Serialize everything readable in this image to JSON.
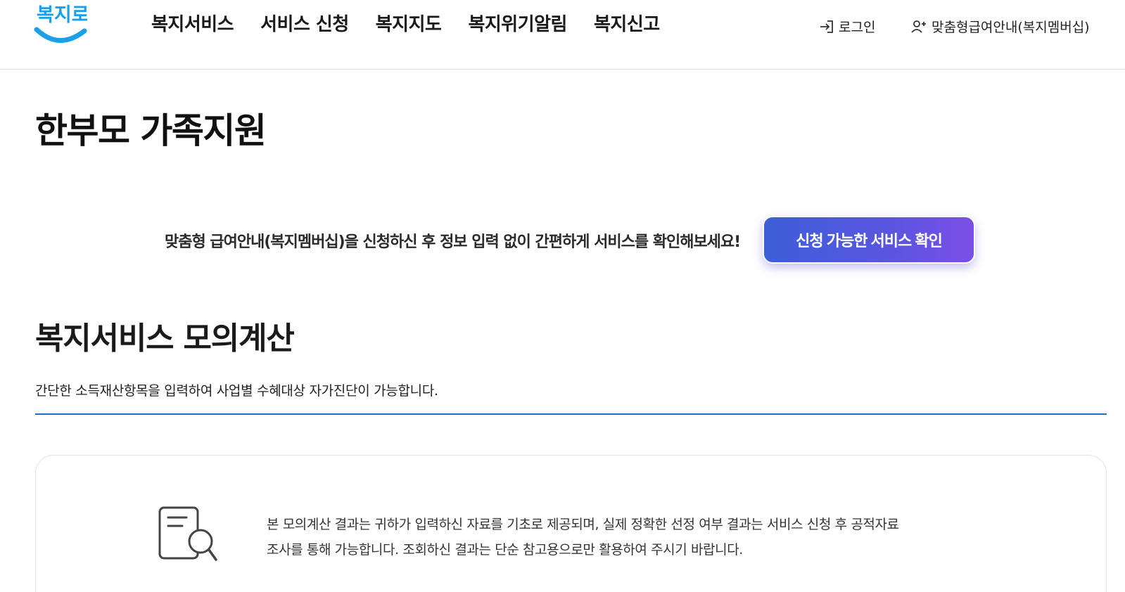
{
  "header": {
    "logo_text": "복지로",
    "nav": [
      {
        "label": "복지서비스"
      },
      {
        "label": "서비스 신청"
      },
      {
        "label": "복지지도"
      },
      {
        "label": "복지위기알림"
      },
      {
        "label": "복지신고"
      }
    ],
    "login_label": "로그인",
    "login_icon": "login-icon",
    "member_label": "맞춤형급여안내(복지멤버십)",
    "member_icon": "user-plus-icon"
  },
  "page": {
    "title": "한부모 가족지원"
  },
  "promo": {
    "text": "맞춤형 급여안내(복지멤버십)을 신청하신 후 정보 입력 없이 간편하게 서비스를 확인해보세요!",
    "button_label": "신청 가능한 서비스 확인"
  },
  "section": {
    "title": "복지서비스 모의계산",
    "description": "간단한 소득재산항목을 입력하여 사업별 수혜대상 자가진단이 가능합니다."
  },
  "notice": {
    "icon": "document-search-icon",
    "line1": "본 모의계산 결과는 귀하가 입력하신 자료를 기초로 제공되며, 실제 정확한 선정 여부 결과는 서비스 신청 후 공적자료",
    "line2": "조사를 통해 가능합니다. 조회하신 결과는 단순 참고용으로만 활용하여 주시기 바랍니다."
  },
  "colors": {
    "logo_blue": "#1aa0e6",
    "accent_rule": "#1f6fc4",
    "button_start": "#3d5fd8",
    "button_end": "#7b4fe6"
  }
}
